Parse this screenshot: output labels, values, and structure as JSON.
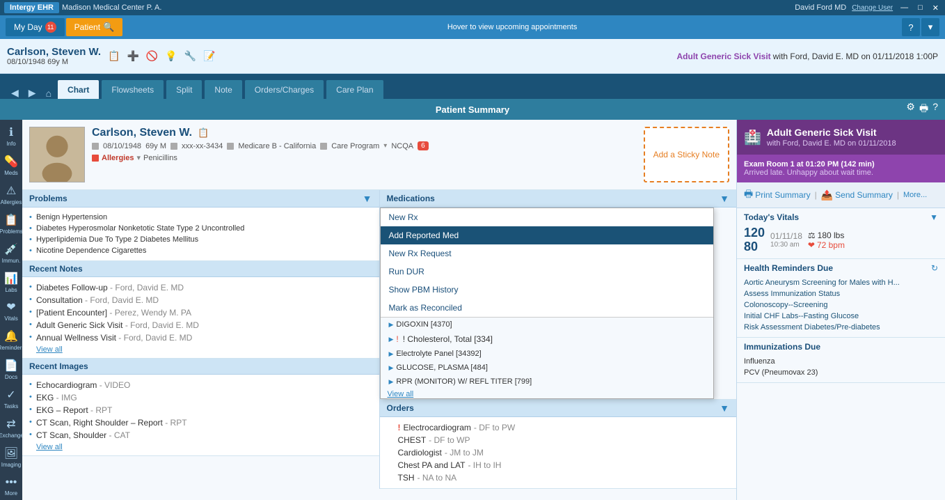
{
  "titlebar": {
    "app_name": "Intergy EHR",
    "facility": "Madison Medical Center P. A.",
    "user": "David Ford MD",
    "change_user": "Change User",
    "win_min": "—",
    "win_max": "□",
    "win_close": "✕"
  },
  "navbar": {
    "my_day": "My Day",
    "my_day_badge": "11",
    "patient": "Patient",
    "hover_msg": "Hover to view upcoming appointments",
    "help_icon": "?",
    "settings_icon": "▾"
  },
  "patient_bar": {
    "name": "Carlson, Steven W.",
    "dob_age": "08/10/1948  69y M",
    "appt_label": "Adult Generic Sick Visit",
    "appt_with": "with Ford, David E. MD",
    "appt_date": "on 01/11/2018  1:00P"
  },
  "chart_tabs": {
    "back": "◀",
    "forward": "▶",
    "home": "⌂",
    "title": "Patient Summary",
    "tabs": [
      "Chart",
      "Flowsheets",
      "Split",
      "Note",
      "Orders/Charges",
      "Care Plan"
    ],
    "active_tab": "Chart",
    "settings_icon": "⚙",
    "print_icon": "🖶",
    "help_icon": "?"
  },
  "left_sidebar": {
    "items": [
      {
        "label": "Info",
        "icon": "ℹ"
      },
      {
        "label": "Meds",
        "icon": "💊"
      },
      {
        "label": "Allergies",
        "icon": "⚠"
      },
      {
        "label": "Problems",
        "icon": "📋"
      },
      {
        "label": "Immun.",
        "icon": "💉"
      },
      {
        "label": "Labs",
        "icon": "📊"
      },
      {
        "label": "Vitals",
        "icon": "❤"
      },
      {
        "label": "Reminders",
        "icon": "🔔"
      },
      {
        "label": "Docs",
        "icon": "📄"
      },
      {
        "label": "Tasks",
        "icon": "✓"
      },
      {
        "label": "Exchange",
        "icon": "⇄"
      },
      {
        "label": "Imaging",
        "icon": "🖼"
      },
      {
        "label": "More",
        "icon": "•••"
      }
    ]
  },
  "patient_summary": {
    "name": "Carlson, Steven W.",
    "copy_icon": "📋",
    "dob": "08/10/1948",
    "age_gender": "69y  M",
    "mrn": "xxx-xx-3434",
    "insurance": "Medicare B - California",
    "care_program": "Care Program",
    "ncqa": "NCQA",
    "ncqa_count": "6",
    "allergies_label": "Allergies",
    "allergies_val": "Penicillins",
    "sticky_note_btn": "Add a Sticky Note"
  },
  "problems": {
    "title": "Problems",
    "items": [
      "Benign Hypertension",
      "Diabetes Hyperosmolar Nonketotic State Type 2 Uncontrolled",
      "Hyperlipidemia Due To Type 2 Diabetes Mellitus",
      "Nicotine Dependence Cigarettes"
    ]
  },
  "recent_notes": {
    "title": "Recent Notes",
    "items": [
      {
        "text": "Diabetes Follow-up",
        "sub": " - Ford, David E. MD"
      },
      {
        "text": "Consultation",
        "sub": " - Ford, David E. MD"
      },
      {
        "text": "[Patient Encounter]",
        "sub": " - Perez, Wendy M. PA"
      },
      {
        "text": "Adult Generic Sick Visit",
        "sub": " - Ford, David E. MD"
      },
      {
        "text": "Annual Wellness Visit",
        "sub": " - Ford, David E. MD"
      }
    ],
    "view_all": "View all"
  },
  "recent_images": {
    "title": "Recent Images",
    "items": [
      {
        "text": "Echocardiogram",
        "sub": " - VIDEO"
      },
      {
        "text": "EKG",
        "sub": " - IMG"
      },
      {
        "text": "EKG – Report",
        "sub": " - RPT"
      },
      {
        "text": "CT Scan, Right Shoulder – Report",
        "sub": " - RPT"
      },
      {
        "text": "CT Scan, Shoulder",
        "sub": " - CAT"
      }
    ],
    "view_all": "View all"
  },
  "medications": {
    "title": "Medications",
    "menu": [
      {
        "label": "New Rx",
        "selected": false
      },
      {
        "label": "Add Reported Med",
        "selected": true
      },
      {
        "label": "New Rx Request",
        "selected": false
      },
      {
        "label": "Run DUR",
        "selected": false
      },
      {
        "label": "Show PBM History",
        "selected": false
      },
      {
        "label": "Mark as Reconciled",
        "selected": false
      }
    ],
    "items": [
      {
        "text": "DIGOXIN [4370]",
        "exclaim": false
      },
      {
        "text": "! Cholesterol, Total [334]",
        "exclaim": true
      },
      {
        "text": "Electrolyte Panel [34392]",
        "exclaim": false
      },
      {
        "text": "GLUCOSE, PLASMA [484]",
        "exclaim": false
      },
      {
        "text": "RPR (MONITOR) W/ REFL TITER [799]",
        "exclaim": false
      }
    ],
    "view_all": "View all"
  },
  "orders": {
    "title": "Orders",
    "items": [
      {
        "text": "Electrocardiogram",
        "exclaim": true,
        "sub": " - DF to PW"
      },
      {
        "text": "CHEST",
        "exclaim": false,
        "sub": " - DF to WP"
      },
      {
        "text": "Cardiologist",
        "exclaim": false,
        "sub": " - JM to JM"
      },
      {
        "text": "Chest PA and LAT",
        "exclaim": false,
        "sub": " - IH to IH"
      },
      {
        "text": "TSH",
        "exclaim": false,
        "sub": " - NA to NA"
      }
    ]
  },
  "right_panel": {
    "visit_title": "Adult Generic Sick Visit",
    "visit_sub": "with Ford, David E. MD on 01/11/2018",
    "exam_room": "Exam Room 1 at 01:20 PM  (142 min)",
    "exam_note": "Arrived late. Unhappy about wait time.",
    "print_summary": "Print Summary",
    "send_summary": "Send Summary",
    "more": "More...",
    "vitals": {
      "title": "Today's Vitals",
      "bp_sys": "120",
      "bp_dia": "80",
      "date": "01/11/18",
      "time": "10:30 am",
      "weight": "180 lbs",
      "hr": "72 bpm"
    },
    "health_reminders": {
      "title": "Health Reminders Due",
      "items": [
        "Aortic Aneurysm Screening for Males with H...",
        "Assess Immunization Status",
        "Colonoscopy--Screening",
        "Initial CHF Labs--Fasting Glucose",
        "Risk Assessment Diabetes/Pre-diabetes"
      ]
    },
    "immunizations_due": {
      "title": "Immunizations Due",
      "items": [
        "Influenza",
        "PCV (Pneumovax 23)"
      ]
    }
  }
}
